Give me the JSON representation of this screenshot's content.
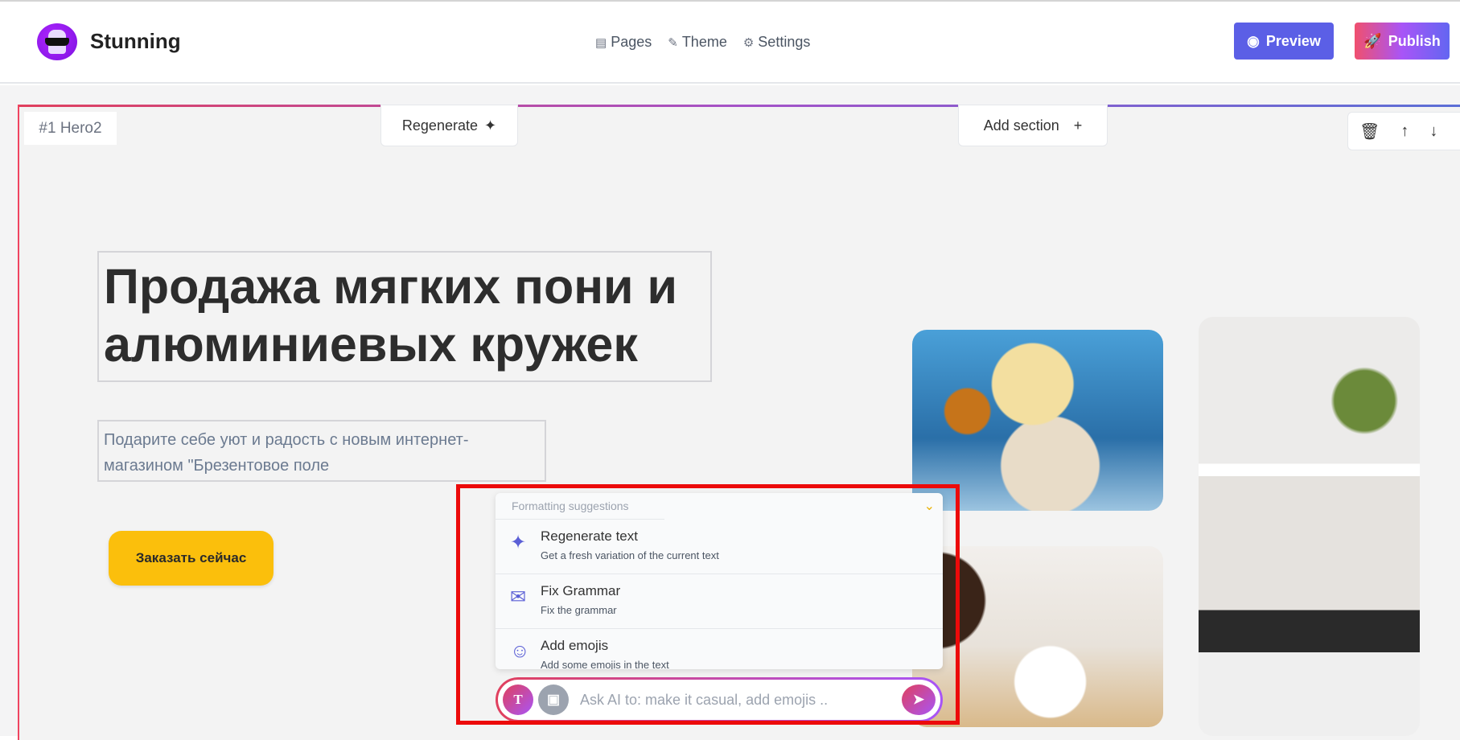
{
  "header": {
    "brand": "Stunning",
    "nav": [
      {
        "label": "Pages",
        "icon": "pages-icon"
      },
      {
        "label": "Theme",
        "icon": "brush-icon"
      },
      {
        "label": "Settings",
        "icon": "gear-icon"
      }
    ],
    "preview_label": "Preview",
    "publish_label": "Publish"
  },
  "section": {
    "tag": "#1 Hero2",
    "regenerate_label": "Regenerate",
    "add_section_label": "Add section"
  },
  "hero": {
    "title": "Продажа мягких пони и алюминиевых кружек",
    "subtitle": "Подарите себе уют и радость с новым интернет-магазином \"Брезентовое поле",
    "cta": "Заказать сейчас"
  },
  "popup": {
    "header": "Formatting suggestions",
    "items": [
      {
        "title": "Regenerate text",
        "desc": "Get a fresh variation of the current text"
      },
      {
        "title": "Fix Grammar",
        "desc": "Fix the grammar"
      },
      {
        "title": "Add emojis",
        "desc": "Add some emojis in the text"
      }
    ]
  },
  "ask": {
    "placeholder": "Ask AI to: make it casual, add emojis ..",
    "text_button": "T"
  },
  "colors": {
    "preview": "#5b5fe6",
    "cta": "#fbbf0c",
    "highlight": "#ec0a0a"
  }
}
